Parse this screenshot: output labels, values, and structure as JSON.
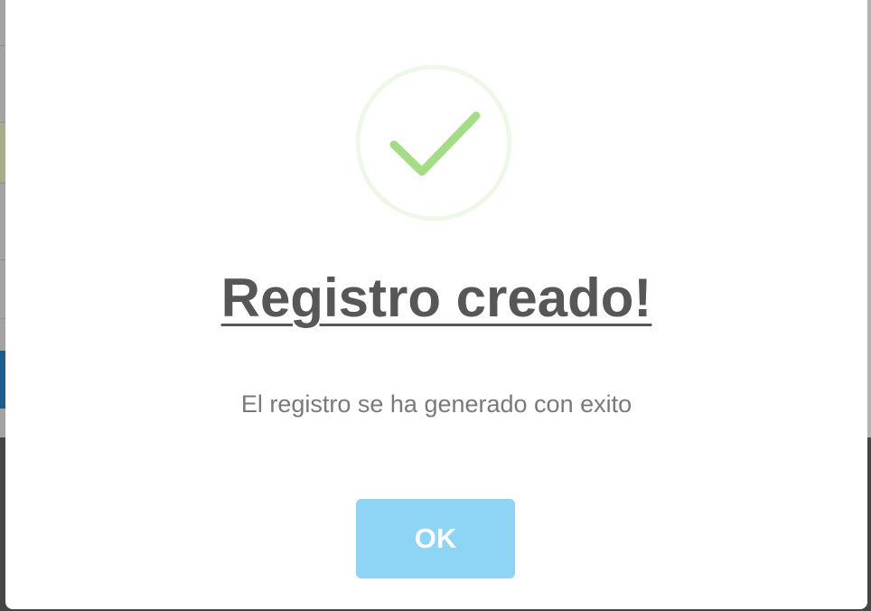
{
  "dialog": {
    "title": "Registro creado!",
    "message": "El registro se ha generado con exito",
    "confirm_label": "OK",
    "icon": "success-check-icon"
  },
  "colors": {
    "check_stroke": "#a5dc86",
    "check_ring": "#eef8e8",
    "title_text": "#575757",
    "message_text": "#797979",
    "button_bg": "#8ed4f5",
    "button_text": "#ffffff"
  }
}
